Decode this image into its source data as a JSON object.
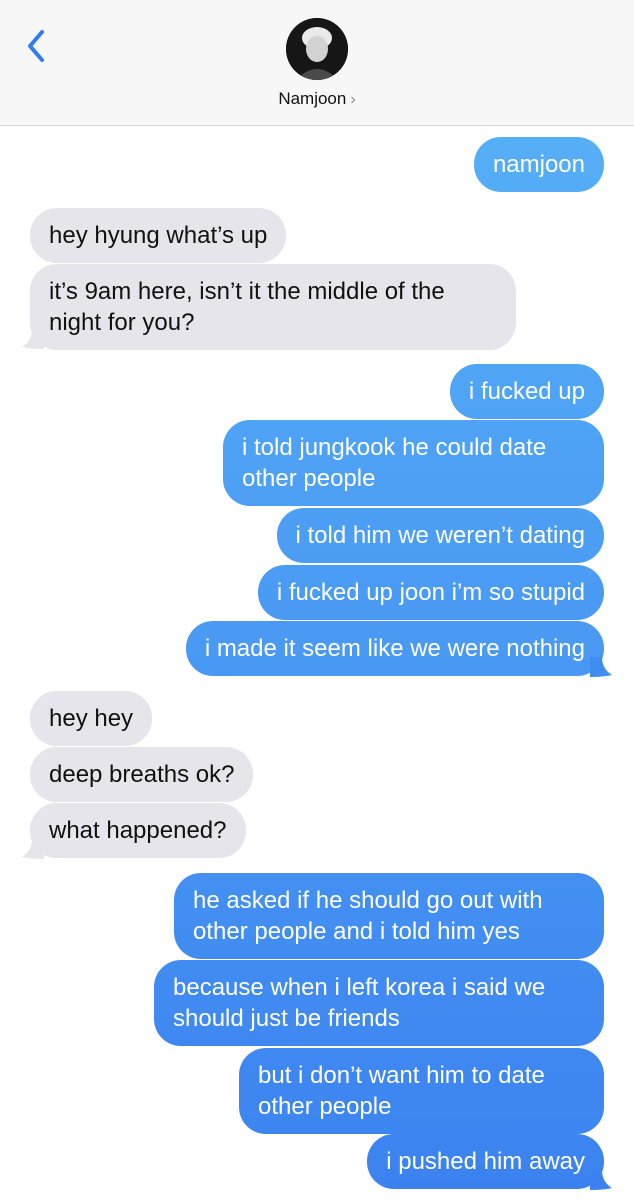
{
  "header": {
    "contact_name": "Namjoon",
    "chevron": "›",
    "back_icon": "chevron-left-icon"
  },
  "colors": {
    "outgoing_top": "#5ab4f7",
    "outgoing_bottom": "#3b82f0",
    "incoming": "#e6e5eb",
    "accent": "#2f7cf6"
  },
  "messages": [
    {
      "side": "out",
      "text": "namjoon"
    },
    {
      "side": "in",
      "text": "hey hyung what’s up"
    },
    {
      "side": "in",
      "text": "it’s 9am here, isn’t it the middle of the night for you?"
    },
    {
      "side": "out",
      "text": "i fucked up"
    },
    {
      "side": "out",
      "text": "i told jungkook he could date other people"
    },
    {
      "side": "out",
      "text": "i told him we weren’t dating"
    },
    {
      "side": "out",
      "text": "i fucked up joon i’m so stupid"
    },
    {
      "side": "out",
      "text": "i made it seem like we were nothing"
    },
    {
      "side": "in",
      "text": "hey hey"
    },
    {
      "side": "in",
      "text": "deep breaths ok?"
    },
    {
      "side": "in",
      "text": "what happened?"
    },
    {
      "side": "out",
      "text": "he asked if he should go out with other people and i told him yes"
    },
    {
      "side": "out",
      "text": "because when i left korea i said we should just be friends"
    },
    {
      "side": "out",
      "text": "but i don’t want him to date other people"
    },
    {
      "side": "out",
      "text": "i pushed him away"
    }
  ]
}
